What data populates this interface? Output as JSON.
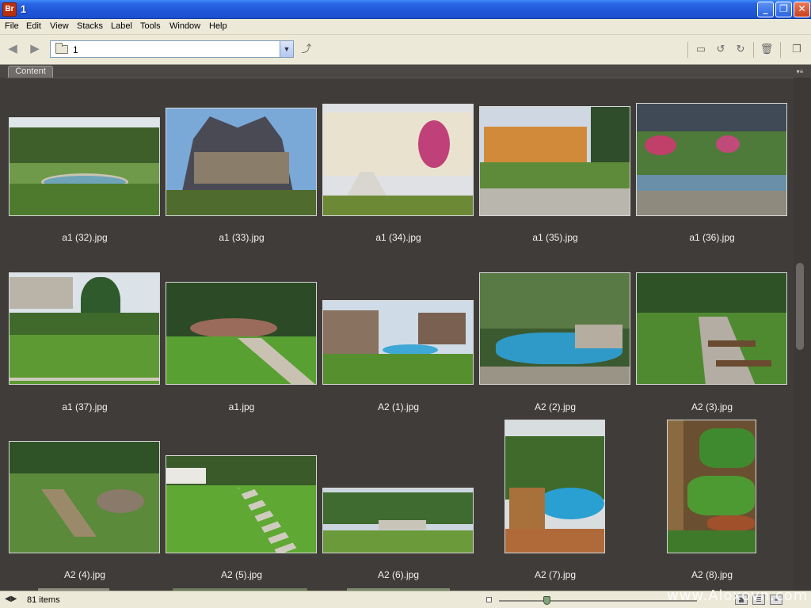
{
  "window": {
    "title": "1",
    "app_badge": "Br"
  },
  "menu": [
    "File",
    "Edit",
    "View",
    "Stacks",
    "Label",
    "Tools",
    "Window",
    "Help"
  ],
  "toolbar": {
    "path": "1"
  },
  "panel": {
    "tab_label": "Content"
  },
  "thumbnails": [
    {
      "name": "a1 (32).jpg"
    },
    {
      "name": "a1 (33).jpg"
    },
    {
      "name": "a1 (34).jpg"
    },
    {
      "name": "a1 (35).jpg"
    },
    {
      "name": "a1 (36).jpg"
    },
    {
      "name": "a1 (37).jpg"
    },
    {
      "name": "a1.jpg"
    },
    {
      "name": "A2 (1).jpg"
    },
    {
      "name": "A2 (2).jpg"
    },
    {
      "name": "A2 (3).jpg"
    },
    {
      "name": "A2 (4).jpg"
    },
    {
      "name": "A2 (5).jpg"
    },
    {
      "name": "A2 (6).jpg"
    },
    {
      "name": "A2 (7).jpg"
    },
    {
      "name": "A2 (8).jpg"
    }
  ],
  "status": {
    "item_count": "81 items"
  },
  "watermark": "www.Aloxovn.com",
  "colors": {
    "titlebar": "#2a66e6",
    "content_bg": "#3f3c3a",
    "chrome": "#ece9d8"
  }
}
